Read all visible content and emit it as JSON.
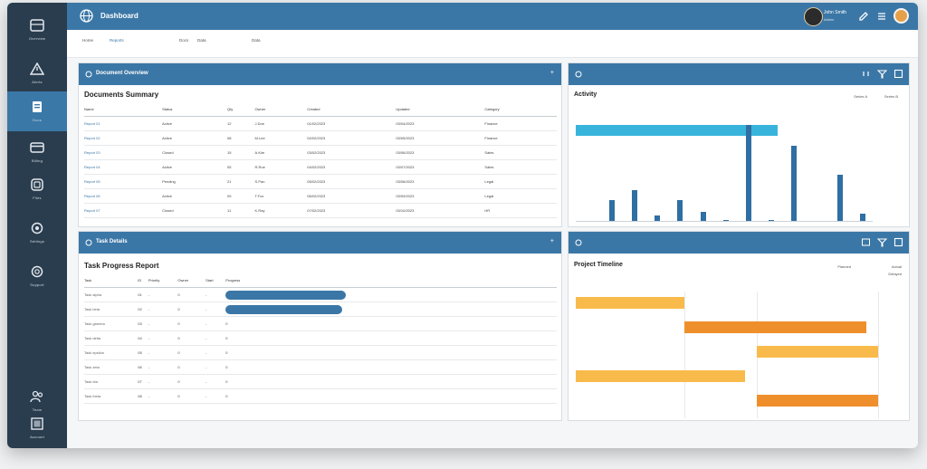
{
  "app": {
    "title": "Dashboard"
  },
  "sidebar": {
    "items": [
      {
        "label": "Overview",
        "icon": "card-icon",
        "active": false
      },
      {
        "label": "Alerts",
        "icon": "alert-icon",
        "active": false
      },
      {
        "label": "Docs",
        "icon": "document-icon",
        "active": true
      },
      {
        "label": "Billing",
        "icon": "credit-card-icon",
        "active": false
      },
      {
        "label": "Files",
        "icon": "file-icon",
        "active": false
      },
      {
        "label": "Settings",
        "icon": "gear-icon",
        "active": false
      },
      {
        "label": "Support",
        "icon": "lifebuoy-icon",
        "active": false
      }
    ],
    "bottom_items": [
      {
        "label": "Team",
        "icon": "users-icon"
      },
      {
        "label": "Account",
        "icon": "grid-icon"
      }
    ]
  },
  "user": {
    "name": "John Smith",
    "role": "Admin"
  },
  "breadcrumbs": [
    "Home",
    "Reports",
    "Docs",
    "Data"
  ],
  "panels": {
    "table1": {
      "header": "Document Overview",
      "title": "Documents Summary",
      "action": "+",
      "columns": [
        "Name",
        "Status",
        "Qty",
        "Owner",
        "Created",
        "Updated",
        "Category"
      ],
      "rows": [
        [
          "Report 01",
          "Active",
          "12",
          "J.Doe",
          "01/02/2023",
          "03/04/2023",
          "Finance"
        ],
        [
          "Report 02",
          "Active",
          "08",
          "M.Lee",
          "02/02/2023",
          "03/05/2023",
          "Finance"
        ],
        [
          "Report 03",
          "Closed",
          "15",
          "A.Kim",
          "03/02/2023",
          "03/06/2023",
          "Sales"
        ],
        [
          "Report 04",
          "Active",
          "05",
          "R.Roe",
          "04/02/2023",
          "03/07/2023",
          "Sales"
        ],
        [
          "Report 05",
          "Pending",
          "21",
          "S.Pan",
          "05/02/2023",
          "03/08/2023",
          "Legal"
        ],
        [
          "Report 06",
          "Active",
          "09",
          "T.Fox",
          "06/02/2023",
          "03/09/2023",
          "Legal"
        ],
        [
          "Report 07",
          "Closed",
          "11",
          "K.Ray",
          "07/02/2023",
          "03/10/2023",
          "HR"
        ]
      ]
    },
    "chart1": {
      "title": "Activity",
      "legend": [
        "Series A",
        "Series B"
      ],
      "icons": [
        "refresh-icon",
        "filter-icon",
        "expand-icon"
      ]
    },
    "table2": {
      "header": "Task Details",
      "title": "Task Progress Report",
      "action": "+",
      "columns": [
        "Task",
        "ID",
        "Priority",
        "Owner",
        "Start",
        "Progress"
      ],
      "rows": [
        {
          "cells": [
            "Task alpha",
            "01",
            "-",
            "0",
            "-",
            "0"
          ],
          "progress": 0.95
        },
        {
          "cells": [
            "Task beta",
            "02",
            "-",
            "0",
            "-",
            "0"
          ],
          "progress": 0.92
        },
        {
          "cells": [
            "Task gamma",
            "03",
            "-",
            "0",
            "-",
            "0"
          ],
          "progress": 0
        },
        {
          "cells": [
            "Task delta",
            "04",
            "-",
            "0",
            "-",
            "0"
          ],
          "progress": 0
        },
        {
          "cells": [
            "Task epsilon",
            "05",
            "-",
            "0",
            "-",
            "0"
          ],
          "progress": 0
        },
        {
          "cells": [
            "Task zeta",
            "06",
            "-",
            "0",
            "-",
            "0"
          ],
          "progress": 0
        },
        {
          "cells": [
            "Task eta",
            "07",
            "-",
            "0",
            "-",
            "0"
          ],
          "progress": 0
        },
        {
          "cells": [
            "Task theta",
            "08",
            "-",
            "0",
            "-",
            "0"
          ],
          "progress": 0
        }
      ]
    },
    "chart2": {
      "title": "Project Timeline",
      "legend": [
        "Planned",
        "Actual",
        "Delayed"
      ],
      "icons": [
        "image-icon",
        "filter-icon",
        "expand-icon"
      ]
    }
  },
  "colors": {
    "primary": "#3b77a6",
    "sidebar": "#2a3d4e",
    "cyan": "#38b4dc",
    "amber": "#f8bb4b",
    "orange": "#ef8f2c"
  },
  "chart_data": [
    {
      "type": "bar",
      "title": "Activity",
      "series": [
        {
          "name": "Series A",
          "color": "#38b4dc",
          "values": [
            100,
            0,
            0,
            0,
            0,
            0,
            0,
            0,
            0,
            0,
            0,
            0,
            0
          ]
        },
        {
          "name": "Series B",
          "color": "#2f6fa3",
          "values": [
            0,
            22,
            32,
            6,
            22,
            9,
            1,
            100,
            1,
            78,
            0,
            48,
            8
          ]
        }
      ],
      "ylim": [
        0,
        100
      ]
    },
    {
      "type": "bar",
      "orientation": "horizontal-gantt",
      "title": "Project Timeline",
      "tasks": [
        {
          "start": 0,
          "end": 0.36,
          "color": "#f8bb4b"
        },
        {
          "start": 0.36,
          "end": 0.96,
          "color": "#ef8f2c"
        },
        {
          "start": 0.6,
          "end": 1.0,
          "color": "#f8bb4b"
        },
        {
          "start": 0,
          "end": 0.56,
          "color": "#f8bb4b"
        },
        {
          "start": 0.6,
          "end": 1.0,
          "color": "#ef8f2c"
        }
      ],
      "xlim": [
        0,
        1
      ]
    }
  ]
}
